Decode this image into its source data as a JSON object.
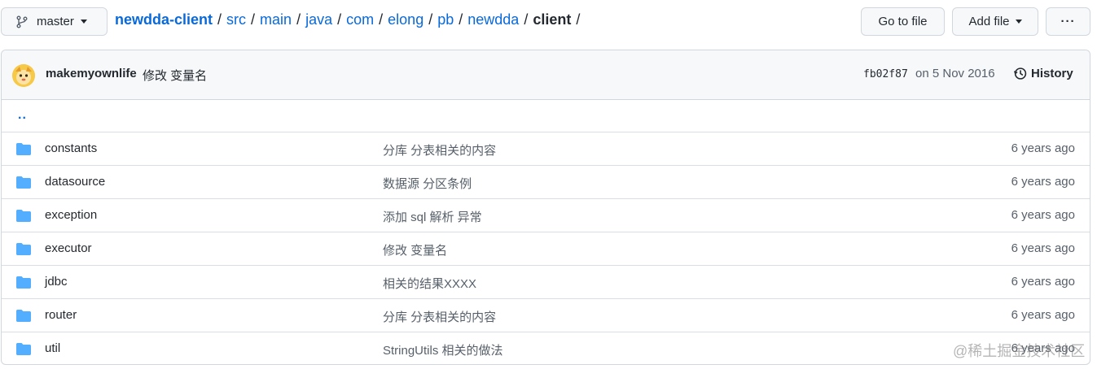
{
  "branch": {
    "label": "master",
    "icon": "git-branch-icon"
  },
  "breadcrumb": {
    "repo": "newdda-client",
    "segments": [
      "src",
      "main",
      "java",
      "com",
      "elong",
      "pb",
      "newdda"
    ],
    "current": "client",
    "sep": "/"
  },
  "actions": {
    "goto_file": "Go to file",
    "add_file": "Add file",
    "more": "···"
  },
  "commit": {
    "author": "makemyownlife",
    "message": "修改 变量名",
    "sha": "fb02f87",
    "date": "on 5 Nov 2016",
    "history_label": "History"
  },
  "parent_link": "..",
  "files": [
    {
      "name": "constants",
      "message": "分库 分表相关的内容",
      "age": "6 years ago"
    },
    {
      "name": "datasource",
      "message": "数据源 分区条例",
      "age": "6 years ago"
    },
    {
      "name": "exception",
      "message": "添加 sql 解析 异常",
      "age": "6 years ago"
    },
    {
      "name": "executor",
      "message": "修改 变量名",
      "age": "6 years ago"
    },
    {
      "name": "jdbc",
      "message": "相关的结果XXXX",
      "age": "6 years ago"
    },
    {
      "name": "router",
      "message": "分库 分表相关的内容",
      "age": "6 years ago"
    },
    {
      "name": "util",
      "message": "StringUtils 相关的做法",
      "age": "6 years ago"
    }
  ],
  "watermark": "@稀土掘金技术社区",
  "colors": {
    "link": "#0969da",
    "folder": "#54aeff",
    "border": "#d0d7de",
    "muted": "#57606a"
  }
}
